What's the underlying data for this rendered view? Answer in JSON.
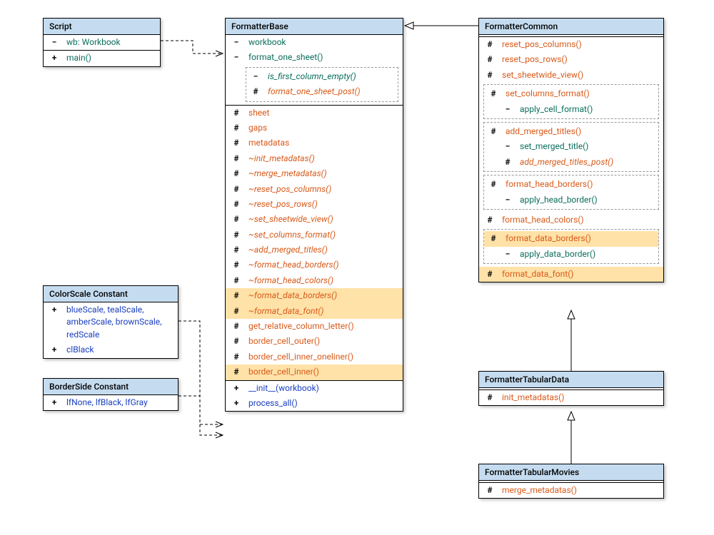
{
  "diagram_type": "UML class diagram",
  "classes": {
    "script": {
      "name": "Script",
      "attrs": [
        {
          "vis": "−",
          "text": "wb: Workbook",
          "color": "c-teal"
        }
      ],
      "ops": [
        {
          "vis": "+",
          "text": "main()",
          "color": "c-teal"
        }
      ]
    },
    "colorscale": {
      "name": "ColorScale Constant",
      "attrs": [
        {
          "vis": "+",
          "text": "blueScale, tealScale, amberScale, brownScale, redScale",
          "color": "c-blue"
        },
        {
          "vis": "+",
          "text": "clBlack",
          "color": "c-blue"
        }
      ]
    },
    "borderside": {
      "name": "BorderSide Constant",
      "attrs": [
        {
          "vis": "+",
          "text": "lfNone, lfBlack, lfGray",
          "color": "c-blue"
        }
      ]
    },
    "formatterbase": {
      "name": "FormatterBase",
      "priv": [
        {
          "vis": "−",
          "text": "workbook",
          "color": "c-teal"
        },
        {
          "vis": "−",
          "text": "format_one_sheet()",
          "color": "c-teal",
          "nested": [
            {
              "vis": "−",
              "text": "is_first_column_empty()",
              "color": "c-teal",
              "italic": true
            },
            {
              "vis": "#",
              "text": "format_one_sheet_post()",
              "color": "c-orange",
              "italic": true
            }
          ]
        }
      ],
      "prot": [
        {
          "vis": "#",
          "text": "sheet",
          "color": "c-orange"
        },
        {
          "vis": "#",
          "text": "gaps",
          "color": "c-orange"
        },
        {
          "vis": "#",
          "text": "metadatas",
          "color": "c-orange"
        },
        {
          "vis": "#",
          "text": "~init_metadatas()",
          "color": "c-orange",
          "italic": true
        },
        {
          "vis": "#",
          "text": "~merge_metadatas()",
          "color": "c-orange",
          "italic": true
        },
        {
          "vis": "#",
          "text": "~reset_pos_columns()",
          "color": "c-orange",
          "italic": true
        },
        {
          "vis": "#",
          "text": "~reset_pos_rows()",
          "color": "c-orange",
          "italic": true
        },
        {
          "vis": "#",
          "text": "~set_sheetwide_view()",
          "color": "c-orange",
          "italic": true
        },
        {
          "vis": "#",
          "text": "~set_columns_format()",
          "color": "c-orange",
          "italic": true
        },
        {
          "vis": "#",
          "text": "~add_merged_titles()",
          "color": "c-orange",
          "italic": true
        },
        {
          "vis": "#",
          "text": "~format_head_borders()",
          "color": "c-orange",
          "italic": true
        },
        {
          "vis": "#",
          "text": "~format_head_colors()",
          "color": "c-orange",
          "italic": true
        },
        {
          "vis": "#",
          "text": "~format_data_borders()",
          "color": "c-orange",
          "italic": true,
          "hl": true
        },
        {
          "vis": "#",
          "text": "~format_data_font()",
          "color": "c-orange",
          "italic": true,
          "hl": true
        },
        {
          "vis": "#",
          "text": "get_relative_column_letter()",
          "color": "c-orange"
        },
        {
          "vis": "#",
          "text": "border_cell_outer()",
          "color": "c-orange"
        },
        {
          "vis": "#",
          "text": "border_cell_inner_oneliner()",
          "color": "c-orange"
        },
        {
          "vis": "#",
          "text": "border_cell_inner()",
          "color": "c-orange",
          "hl": true
        }
      ],
      "pub": [
        {
          "vis": "+",
          "text": "__init__(workbook)",
          "color": "c-blue"
        },
        {
          "vis": "+",
          "text": "process_all()",
          "color": "c-blue"
        }
      ]
    },
    "formattercommon": {
      "name": "FormatterCommon",
      "members": [
        {
          "vis": "#",
          "text": "reset_pos_columns()",
          "color": "c-orange"
        },
        {
          "vis": "#",
          "text": "reset_pos_rows()",
          "color": "c-orange"
        },
        {
          "vis": "#",
          "text": "set_sheetwide_view()",
          "color": "c-orange"
        },
        {
          "vis": "#",
          "text": "set_columns_format()",
          "color": "c-orange",
          "nested": [
            {
              "vis": "−",
              "text": "apply_cell_format()",
              "color": "c-teal"
            }
          ]
        },
        {
          "vis": "#",
          "text": "add_merged_titles()",
          "color": "c-orange",
          "nested": [
            {
              "vis": "−",
              "text": "set_merged_title()",
              "color": "c-teal"
            },
            {
              "vis": "#",
              "text": "add_merged_titles_post()",
              "color": "c-orange",
              "italic": true
            }
          ]
        },
        {
          "vis": "#",
          "text": "format_head_borders()",
          "color": "c-orange",
          "nested": [
            {
              "vis": "−",
              "text": "apply_head_border()",
              "color": "c-teal"
            }
          ]
        },
        {
          "vis": "#",
          "text": "format_head_colors()",
          "color": "c-orange"
        },
        {
          "vis": "#",
          "text": "format_data_borders()",
          "color": "c-orange",
          "hl": true,
          "nested": [
            {
              "vis": "−",
              "text": "apply_data_border()",
              "color": "c-teal"
            }
          ]
        },
        {
          "vis": "#",
          "text": "format_data_font()",
          "color": "c-orange",
          "hl": true
        }
      ]
    },
    "formattertabulardata": {
      "name": "FormatterTabularData",
      "members": [
        {
          "vis": "#",
          "text": "init_metadatas()",
          "color": "c-orange"
        }
      ]
    },
    "formattertabularmovies": {
      "name": "FormatterTabularMovies",
      "members": [
        {
          "vis": "#",
          "text": "merge_metadatas()",
          "color": "c-orange"
        }
      ]
    }
  },
  "relations": [
    {
      "from": "FormatterCommon",
      "to": "FormatterBase",
      "type": "generalization"
    },
    {
      "from": "FormatterTabularData",
      "to": "FormatterCommon",
      "type": "generalization"
    },
    {
      "from": "FormatterTabularMovies",
      "to": "FormatterTabularData",
      "type": "generalization"
    },
    {
      "from": "Script",
      "to": "FormatterBase",
      "type": "dependency"
    },
    {
      "from": "ColorScale Constant",
      "to": "FormatterBase",
      "type": "dependency"
    },
    {
      "from": "BorderSide Constant",
      "to": "FormatterBase",
      "type": "dependency"
    }
  ]
}
